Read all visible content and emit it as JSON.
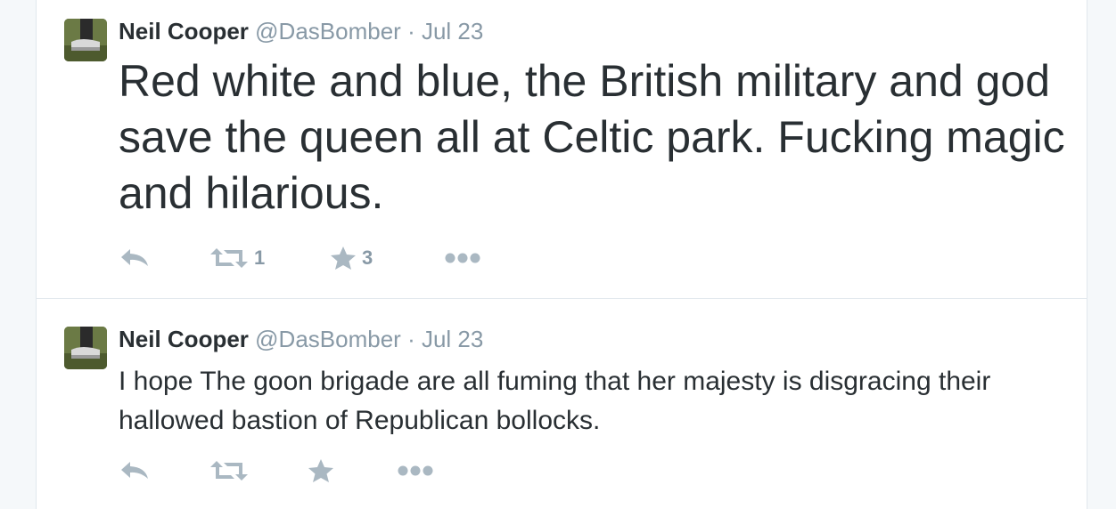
{
  "tweets": [
    {
      "fullname": "Neil Cooper",
      "username": "@DasBomber",
      "separator": "·",
      "time": "Jul 23",
      "text": "Red white and blue, the British military and god save the queen all at Celtic park. Fucking magic and hilarious.",
      "retweet_count": "1",
      "favorite_count": "3",
      "icons": [
        "reply-icon",
        "retweet-icon",
        "favorite-icon",
        "more-icon"
      ]
    },
    {
      "fullname": "Neil Cooper",
      "username": "@DasBomber",
      "separator": "·",
      "time": "Jul 23",
      "text": "I hope The goon brigade are all fuming that her majesty is disgracing their hallowed bastion of Republican bollocks.",
      "retweet_count": "",
      "favorite_count": "",
      "icons": [
        "reply-icon",
        "retweet-icon",
        "favorite-icon",
        "more-icon"
      ]
    }
  ],
  "colors": {
    "text": "#292f33",
    "muted": "#8899a6",
    "icon": "#aab8c2",
    "border": "#e1e8ed",
    "background": "#f5f8fa"
  }
}
